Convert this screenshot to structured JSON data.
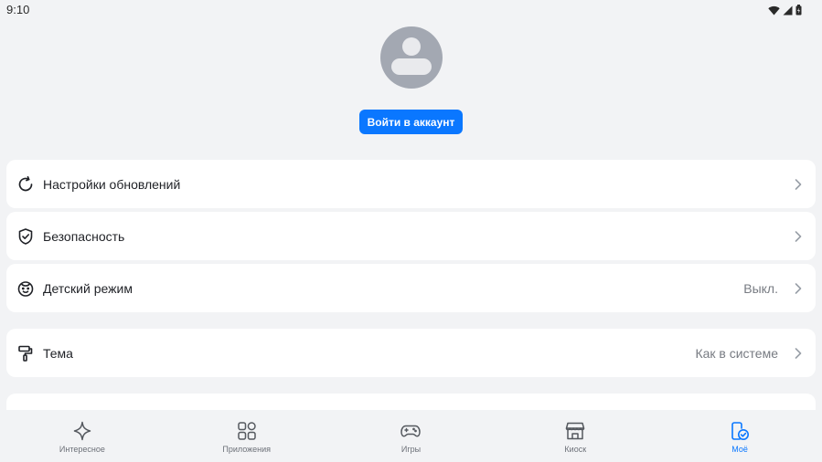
{
  "status_bar": {
    "time": "9:10",
    "icons": [
      "wifi-icon",
      "signal-icon",
      "battery-icon"
    ]
  },
  "profile": {
    "avatar_icon": "avatar-placeholder-icon",
    "login_button": "Войти в аккаунт"
  },
  "settings": [
    {
      "id": "updates",
      "icon": "refresh-icon",
      "label": "Настройки обновлений",
      "value": ""
    },
    {
      "id": "security",
      "icon": "shield-check-icon",
      "label": "Безопасность",
      "value": ""
    },
    {
      "id": "kids",
      "icon": "child-face-icon",
      "label": "Детский режим",
      "value": "Выкл."
    },
    {
      "id": "theme",
      "icon": "paint-roller-icon",
      "label": "Тема",
      "value": "Как в системе"
    }
  ],
  "bottom_nav": [
    {
      "id": "interesting",
      "icon": "sparkle-icon",
      "label": "Интересное",
      "active": false
    },
    {
      "id": "apps",
      "icon": "apps-grid-icon",
      "label": "Приложения",
      "active": false
    },
    {
      "id": "games",
      "icon": "gamepad-icon",
      "label": "Игры",
      "active": false
    },
    {
      "id": "kiosk",
      "icon": "store-icon",
      "label": "Киоск",
      "active": false
    },
    {
      "id": "mine",
      "icon": "my-apps-icon",
      "label": "Моё",
      "active": true
    }
  ],
  "colors": {
    "accent": "#0a77ff",
    "background": "#f2f3f5",
    "card": "#ffffff",
    "avatar": "#a3a8b2",
    "muted_text": "#777b82"
  }
}
